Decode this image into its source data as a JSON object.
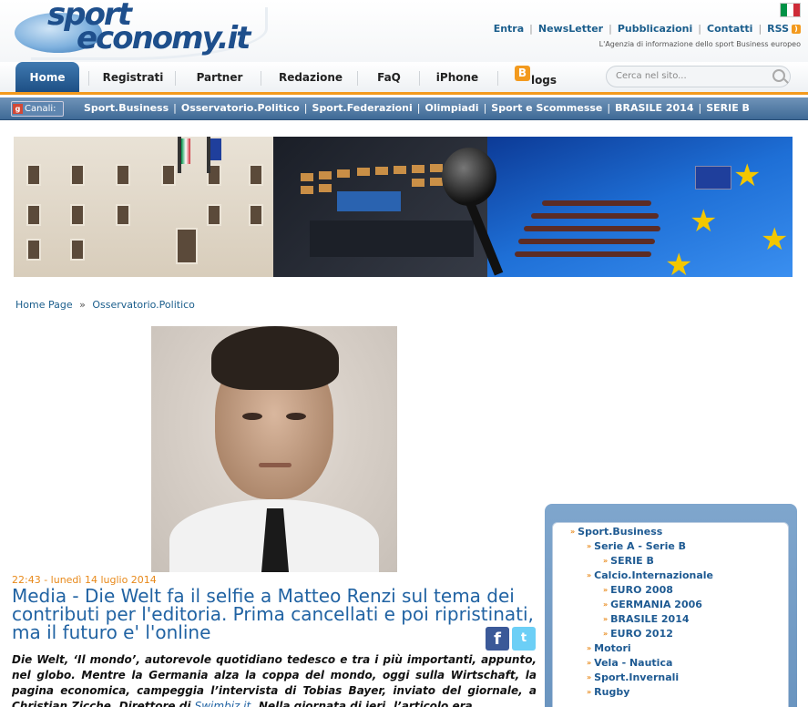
{
  "site": {
    "logo_line1": "sport",
    "logo_line2": "economy.it",
    "tagline": "L'Agenzia di informazione dello sport Business europeo"
  },
  "top_links": {
    "entra": "Entra",
    "newsletter": "NewsLetter",
    "pubblicazioni": "Pubblicazioni",
    "contatti": "Contatti",
    "rss": "RSS"
  },
  "nav": {
    "tabs": [
      "Home",
      "Registrati",
      "Partner",
      "Redazione",
      "FaQ",
      "iPhone",
      "logs"
    ],
    "blog_b": "B",
    "active": "Home",
    "search_placeholder": "Cerca nel sito..."
  },
  "channels": {
    "label": "Canali:",
    "items": [
      "Sport.Business",
      "Osservatorio.Politico",
      "Sport.Federazioni",
      "Olimpiadi",
      "Sport e Scommesse",
      "BRASILE 2014",
      "SERIE B"
    ]
  },
  "breadcrumb": {
    "home": "Home Page",
    "sep": "»",
    "current": "Osservatorio.Politico"
  },
  "article": {
    "timestamp": "22:43 - lunedì 14 luglio 2014",
    "title": "Media - Die Welt fa il selfie a Matteo Renzi sul tema dei contributi per l'editoria. Prima cancellati e poi ripristinati, ma il futuro e' l'online",
    "body_part1": "Die Welt, ‘Il mondo’, autorevole quotidiano tedesco e tra i più importanti, appunto, nel globo. Mentre la Germania alza la coppa del mondo, oggi sulla Wirtschaft, la pagina economica, campeggia l’intervista di Tobias Bayer, inviato del giornale, a Christian Zicche, Direttore di ",
    "body_link": "Swimbiz.it",
    "body_part2": ". Nella giornata di ieri, l’articolo era"
  },
  "share": {
    "facebook": "f",
    "twitter": "t"
  },
  "sidebar": {
    "items": [
      {
        "label": "Sport.Business",
        "level": 0
      },
      {
        "label": "Serie A - Serie B",
        "level": 1
      },
      {
        "label": "SERIE B",
        "level": 2
      },
      {
        "label": "Calcio.Internazionale",
        "level": 1
      },
      {
        "label": "EURO 2008",
        "level": 2
      },
      {
        "label": "GERMANIA 2006",
        "level": 2
      },
      {
        "label": "BRASILE 2014",
        "level": 2
      },
      {
        "label": "EURO 2012",
        "level": 2
      },
      {
        "label": "Motori",
        "level": 1
      },
      {
        "label": "Vela - Nautica",
        "level": 1
      },
      {
        "label": "Sport.Invernali",
        "level": 1
      },
      {
        "label": "Rugby",
        "level": 1
      }
    ]
  },
  "colors": {
    "brand_blue": "#1e4f8c",
    "accent_orange": "#f39a1e",
    "link_blue": "#2163a3"
  }
}
